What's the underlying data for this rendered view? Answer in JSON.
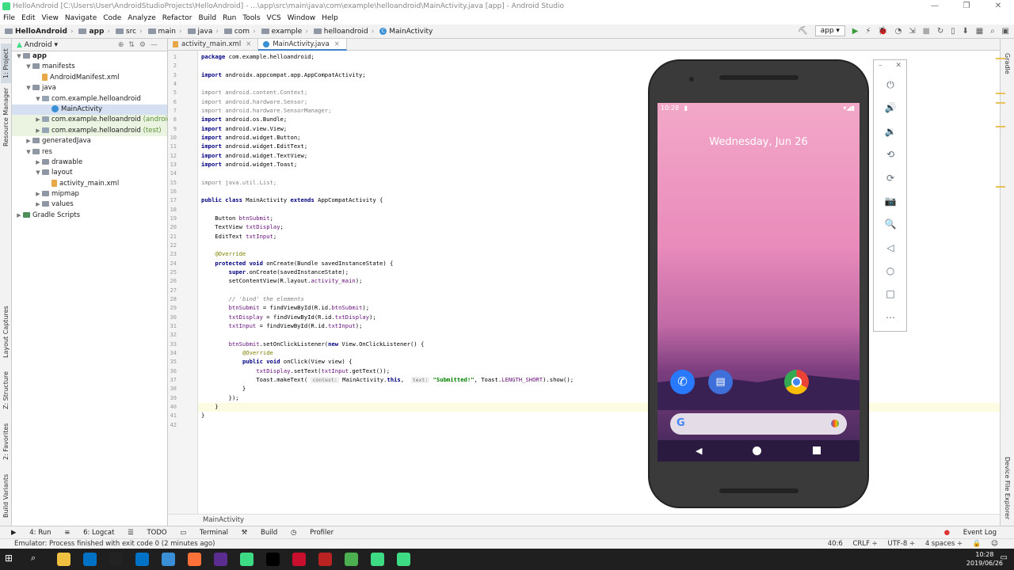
{
  "window": {
    "title": "HelloAndroid [C:\\Users\\User\\AndroidStudioProjects\\HelloAndroid] - ...\\app\\src\\main\\java\\com\\example\\helloandroid\\MainActivity.java [app] - Android Studio",
    "controls": [
      "—",
      "❐",
      "✕"
    ]
  },
  "menu": [
    "File",
    "Edit",
    "View",
    "Navigate",
    "Code",
    "Analyze",
    "Refactor",
    "Build",
    "Run",
    "Tools",
    "VCS",
    "Window",
    "Help"
  ],
  "breadcrumbs": [
    "HelloAndroid",
    "app",
    "src",
    "main",
    "java",
    "com",
    "example",
    "helloandroid",
    "MainActivity"
  ],
  "toolbar": {
    "config": "app ▾"
  },
  "left_tabs": [
    "1: Project",
    "Resource Manager",
    "Layout Captures",
    "Z: Structure",
    "2: Favorites",
    "Build Variants"
  ],
  "project": {
    "view_label": "Android",
    "tree": [
      {
        "label": "app",
        "indent": 0,
        "arrow": "▼",
        "icon": "folder",
        "bold": true
      },
      {
        "label": "manifests",
        "indent": 1,
        "arrow": "▼",
        "icon": "folder"
      },
      {
        "label": "AndroidManifest.xml",
        "indent": 2,
        "arrow": "",
        "icon": "xml"
      },
      {
        "label": "java",
        "indent": 1,
        "arrow": "▼",
        "icon": "folder"
      },
      {
        "label": "com.example.helloandroid",
        "indent": 2,
        "arrow": "▼",
        "icon": "pkg"
      },
      {
        "label": "MainActivity",
        "indent": 3,
        "arrow": "",
        "icon": "cls",
        "selected": true
      },
      {
        "label": "com.example.helloandroid",
        "suffix": "(androidTest)",
        "indent": 2,
        "arrow": "▶",
        "icon": "pkg",
        "highlight": true
      },
      {
        "label": "com.example.helloandroid",
        "suffix": "(test)",
        "indent": 2,
        "arrow": "▶",
        "icon": "pkg",
        "highlight": true
      },
      {
        "label": "generatedJava",
        "indent": 1,
        "arrow": "▶",
        "icon": "folder"
      },
      {
        "label": "res",
        "indent": 1,
        "arrow": "▼",
        "icon": "folder"
      },
      {
        "label": "drawable",
        "indent": 2,
        "arrow": "▶",
        "icon": "folder"
      },
      {
        "label": "layout",
        "indent": 2,
        "arrow": "▼",
        "icon": "folder"
      },
      {
        "label": "activity_main.xml",
        "indent": 3,
        "arrow": "",
        "icon": "xml"
      },
      {
        "label": "mipmap",
        "indent": 2,
        "arrow": "▶",
        "icon": "folder"
      },
      {
        "label": "values",
        "indent": 2,
        "arrow": "▶",
        "icon": "folder"
      },
      {
        "label": "Gradle Scripts",
        "indent": 0,
        "arrow": "▶",
        "icon": "gradle"
      }
    ]
  },
  "tabs": [
    {
      "label": "activity_main.xml",
      "type": "xml"
    },
    {
      "label": "MainActivity.java",
      "type": "class",
      "active": true
    }
  ],
  "code_lines": [
    "<span class=\"kw\">package</span> com.example.helloandroid;",
    "",
    "<span class=\"kw\">import</span> androidx.appcompat.app.AppCompatActivity;",
    "",
    "<span class=\"gr\">import android.content.Context;</span>",
    "<span class=\"gr\">import android.hardware.Sensor;</span>",
    "<span class=\"gr\">import android.hardware.SensorManager;</span>",
    "<span class=\"kw\">import</span> android.os.Bundle;",
    "<span class=\"kw\">import</span> android.view.View;",
    "<span class=\"kw\">import</span> android.widget.Button;",
    "<span class=\"kw\">import</span> android.widget.EditText;",
    "<span class=\"kw\">import</span> android.widget.TextView;",
    "<span class=\"kw\">import</span> android.widget.Toast;",
    "",
    "<span class=\"gr\">import java.util.List;</span>",
    "",
    "<span class=\"kw\">public class</span> MainActivity <span class=\"kw\">extends</span> AppCompatActivity {",
    "",
    "    Button <span class=\"fl\">btnSubmit</span>;",
    "    TextView <span class=\"fl\">txtDisplay</span>;",
    "    EditText <span class=\"fl\">txtInput</span>;",
    "",
    "    <span class=\"an\">@Override</span>",
    "    <span class=\"kw\">protected void</span> onCreate(Bundle savedInstanceState) {",
    "        <span class=\"kw\">super</span>.onCreate(savedInstanceState);",
    "        setContentView(R.layout.<span class=\"fl\">activity_main</span>);",
    "",
    "        <span class=\"cm\">// 'bind' the elements</span>",
    "        <span class=\"fl\">btnSubmit</span> = findViewById(R.id.<span class=\"fl\">btnSubmit</span>);",
    "        <span class=\"fl\">txtDisplay</span> = findViewById(R.id.<span class=\"fl\">txtDisplay</span>);",
    "        <span class=\"fl\">txtInput</span> = findViewById(R.id.<span class=\"fl\">txtInput</span>);",
    "",
    "        <span class=\"fl\">btnSubmit</span>.setOnClickListener(<span class=\"kw\">new</span> View.OnClickListener() {",
    "            <span class=\"an\">@Override</span>",
    "            <span class=\"kw\">public void</span> onClick(View view) {",
    "                <span class=\"fl\">txtDisplay</span>.setText(<span class=\"fl\">txtInput</span>.getText());",
    "                Toast.makeText( <span class=\"hint\">context:</span> MainActivity.<span class=\"kw\">this</span>,  <span class=\"hint\">text:</span> <span class=\"st\">\"Submitted!\"</span>, Toast.<span class=\"fl\">LENGTH_SHORT</span>).show();",
    "            }",
    "        });",
    "    }",
    "}",
    ""
  ],
  "editor_breadcrumb": "MainActivity",
  "right_tabs": [
    "Gradle",
    "Device File Explorer"
  ],
  "bottom_tabs": [
    "4: Run",
    "6: Logcat",
    "TODO",
    "Terminal",
    "Build",
    "Profiler"
  ],
  "event_log": "Event Log",
  "status": {
    "message": "Emulator: Process finished with exit code 0 (2 minutes ago)",
    "position": "40:6",
    "line_sep": "CRLF ÷",
    "encoding": "UTF-8 ÷",
    "indent": "4 spaces ÷"
  },
  "phone": {
    "time": "10:28",
    "date": "Wednesday, Jun 26",
    "google": "G",
    "status_icons": "▾◢▮"
  },
  "emulator_panel": [
    "⏻",
    "🔊",
    "🔉",
    "⟲",
    "⟳",
    "📷",
    "🔍",
    "◁",
    "○",
    "□",
    "⋯"
  ],
  "taskbar": {
    "time": "10:28",
    "date": "2019/06/26",
    "colors": [
      "#ffffff",
      "#2b88d8",
      "#f0c040",
      "#0072c6",
      "#222",
      "#0072c6",
      "#3a8fd6",
      "#ff7139",
      "#5c2d91",
      "#3ddc84",
      "#000",
      "#c8102e",
      "#b22",
      "#4caf50",
      "#3ddc84",
      "#3ddc84"
    ]
  },
  "colors": {
    "accent": "#4083c9",
    "selection": "#d5e1f2"
  }
}
